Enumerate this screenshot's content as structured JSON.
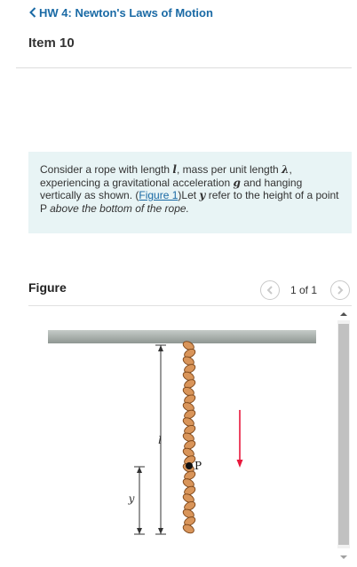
{
  "header": {
    "back_link": "HW 4: Newton's Laws of Motion",
    "item_title": "Item 10"
  },
  "problem": {
    "text_1": "Consider a rope with length ",
    "var_l": "l",
    "text_2": ", mass per unit length ",
    "var_lambda": "λ",
    "text_3": ", experiencing a gravitational acceleration ",
    "var_g": "g",
    "text_4": " and hanging vertically as shown. (",
    "figure_link": "Figure 1",
    "text_5": ")Let ",
    "var_y": "y",
    "text_6": " refer to the height of a point P ",
    "text_emph": "above the bottom of the rope."
  },
  "figure": {
    "title": "Figure",
    "page_count": "1 of 1",
    "label_l": "l",
    "label_y": "y",
    "label_p": "P",
    "prev_icon": "chevron-left-icon",
    "next_icon": "chevron-right-icon"
  },
  "colors": {
    "link": "#1a6aa5",
    "problem_bg": "#e8f4f5",
    "rope": "#d9955a",
    "arrow": "#e8183c",
    "ceiling": "#a9b2ae"
  }
}
